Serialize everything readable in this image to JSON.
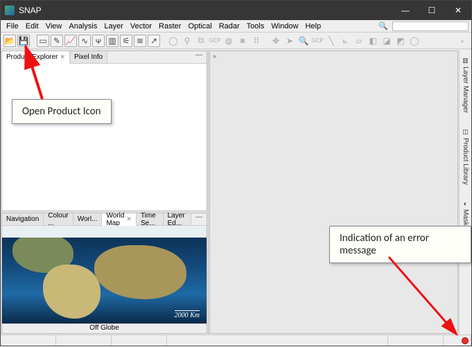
{
  "title": "SNAP",
  "menu": [
    "File",
    "Edit",
    "View",
    "Analysis",
    "Layer",
    "Vector",
    "Raster",
    "Optical",
    "Radar",
    "Tools",
    "Window",
    "Help"
  ],
  "search_placeholder": "",
  "toolbar_sections": {
    "a": [
      "open-file",
      "save"
    ],
    "b": [
      "rect-select",
      "crop",
      "chart",
      "bars",
      "spectrum",
      "histogram",
      "scatter",
      "lineplot",
      "profile"
    ],
    "c": [
      "globe",
      "pin",
      "layers",
      "gcp",
      "mask",
      "grid",
      "cluster"
    ],
    "d": [
      "pan",
      "arrow",
      "zoom-in",
      "gcp2",
      "ruler",
      "angle",
      "polygon",
      "shape",
      "tag",
      "tag2",
      "ellipse"
    ]
  },
  "left_top_tabs": [
    {
      "label": "Product Explorer",
      "active": true,
      "closable": true
    },
    {
      "label": "Pixel Info",
      "active": false,
      "closable": false
    }
  ],
  "left_bot_tabs": [
    {
      "label": "Navigation"
    },
    {
      "label": "Colour ..."
    },
    {
      "label": "Worl..."
    },
    {
      "label": "World Map",
      "active": true,
      "closable": true
    },
    {
      "label": "Time Se..."
    },
    {
      "label": "Layer Ed..."
    }
  ],
  "map_scale": "2000 Km",
  "map_caption": "Off Globe",
  "right_tabs": [
    "Layer Manager",
    "Product Library",
    "Mask Manager"
  ],
  "callouts": {
    "open_product": "Open Product Icon",
    "error_msg": "Indication of an error message"
  }
}
